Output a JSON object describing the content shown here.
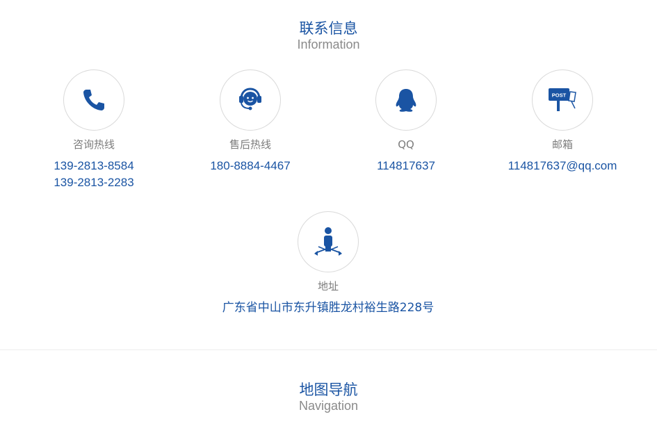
{
  "contact": {
    "title": "联系信息",
    "subtitle": "Information",
    "consult": {
      "icon": "phone-icon",
      "label": "咨询热线",
      "values": [
        "139-2813-8584",
        "139-2813-2283"
      ]
    },
    "aftersales": {
      "icon": "headset-icon",
      "label": "售后热线",
      "values": [
        "180-8884-4467"
      ]
    },
    "qq": {
      "icon": "qq-penguin-icon",
      "label": "QQ",
      "values": [
        "114817637"
      ]
    },
    "email": {
      "icon": "mailbox-post-icon",
      "label": "邮箱",
      "values": [
        "114817637@qq.com"
      ],
      "icon_text": "POST"
    },
    "address": {
      "icon": "person-directions-icon",
      "label": "地址",
      "values": [
        "广东省中山市东升镇胜龙村裕生路228号"
      ]
    }
  },
  "map": {
    "title": "地图导航",
    "subtitle": "Navigation"
  },
  "colors": {
    "accent": "#1a54a3",
    "label": "#7c7c7c",
    "border": "#d9d9d9"
  }
}
